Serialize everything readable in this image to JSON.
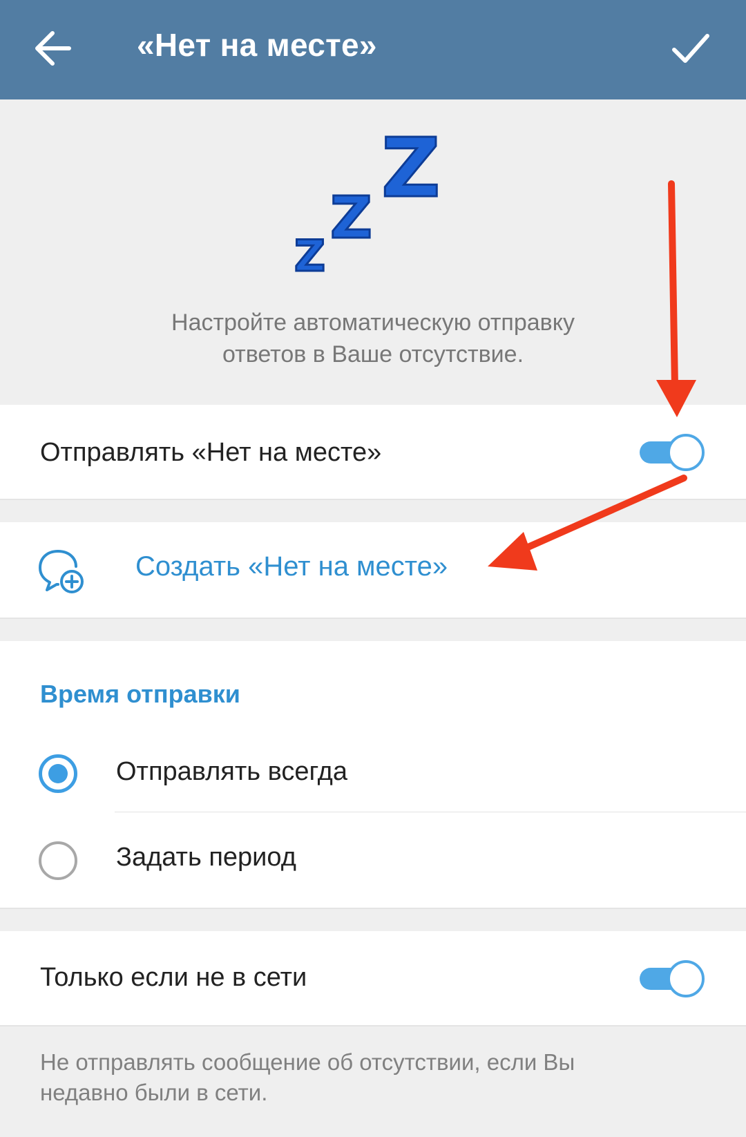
{
  "header": {
    "title": "«Нет на месте»",
    "back_icon": "arrow-left-icon",
    "confirm_icon": "checkmark-icon",
    "background_color": "#527da3"
  },
  "hero": {
    "icon": "zzz-sleep-icon",
    "description_line1": "Настройте автоматическую отправку",
    "description_line2": "ответов в Ваше отсутствие."
  },
  "send_away": {
    "label": "Отправлять «Нет на месте»",
    "enabled": true
  },
  "create_away": {
    "label": "Создать «Нет на месте»",
    "icon": "chat-add-icon"
  },
  "schedule": {
    "title": "Время отправки",
    "options": [
      {
        "label": "Отправлять всегда",
        "selected": true
      },
      {
        "label": "Задать период",
        "selected": false
      }
    ]
  },
  "offline_only": {
    "label": "Только если не в сети",
    "enabled": true,
    "hint_line1": "Не отправлять сообщение об отсутствии, если Вы",
    "hint_line2": "недавно были в сети."
  },
  "colors": {
    "accent": "#4fa8e6",
    "link": "#2f8fd0",
    "annotation_arrow": "#f03a1c"
  }
}
